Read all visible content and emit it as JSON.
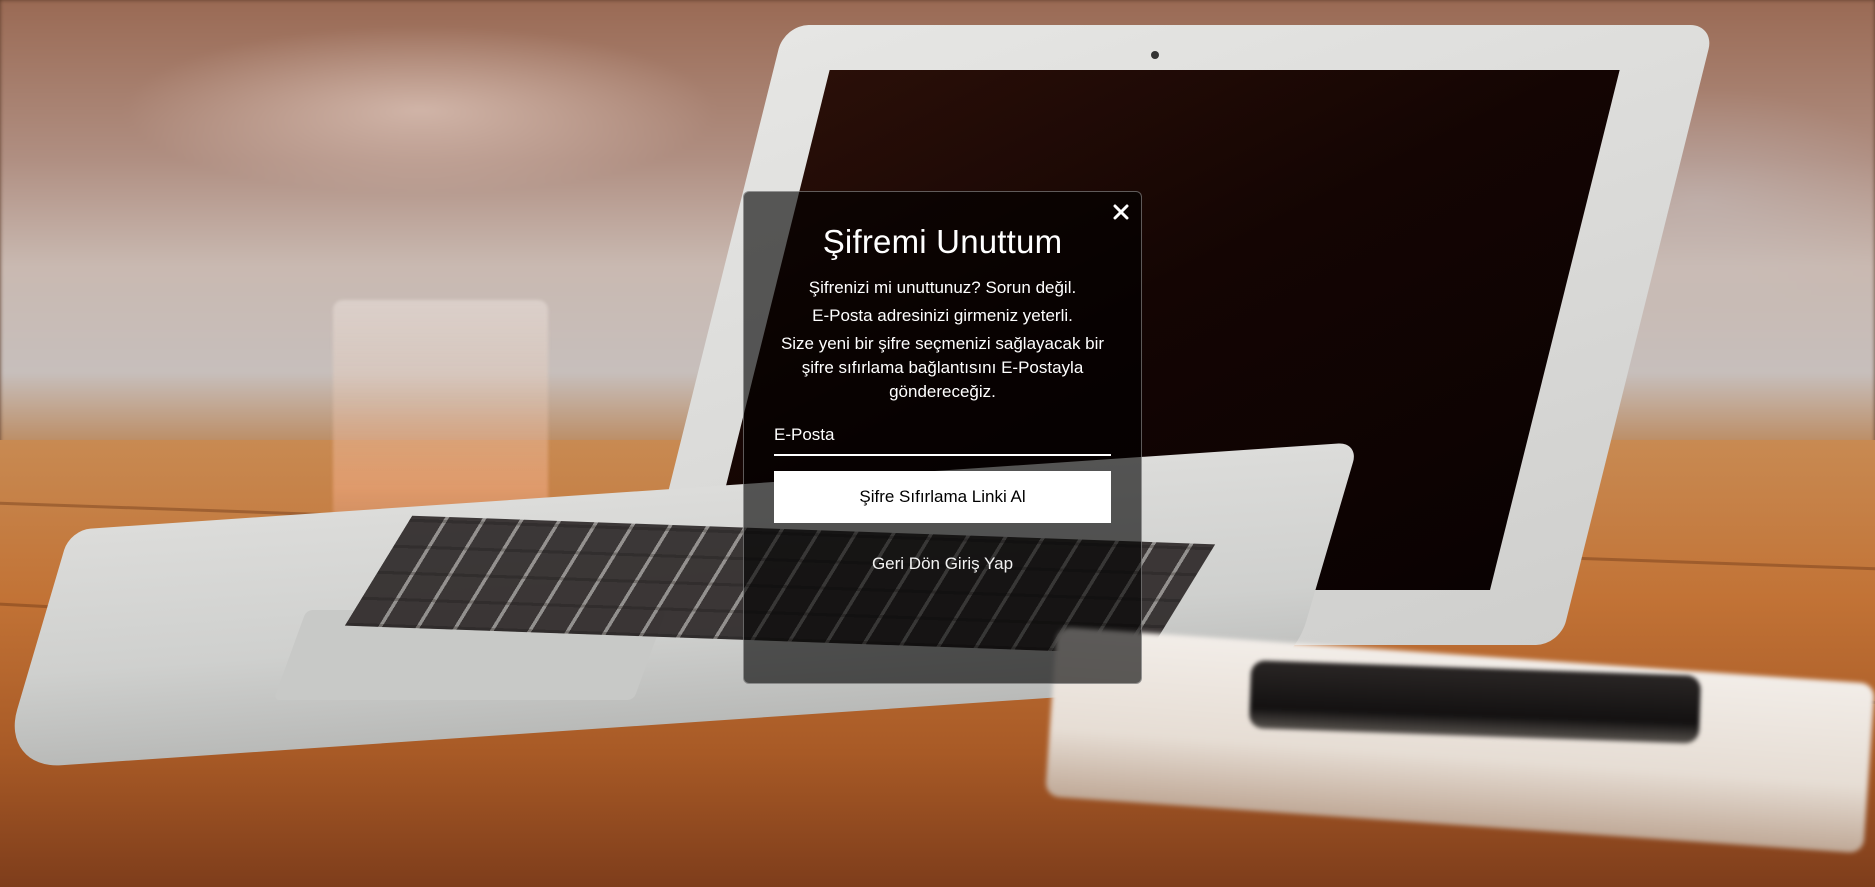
{
  "modal": {
    "title": "Şifremi Unuttum",
    "line1": "Şifrenizi mi unuttunuz? Sorun değil.",
    "line2": "E-Posta adresinizi girmeniz yeterli.",
    "line3": "Size yeni bir şifre seçmenizi sağlayacak bir şifre sıfırlama bağlantısını E-Postayla göndereceğiz.",
    "email_placeholder": "E-Posta",
    "email_value": "",
    "submit_label": "Şifre Sıfırlama Linki Al",
    "back_label": "Geri Dön Giriş Yap",
    "close_icon": "close-icon"
  },
  "colors": {
    "overlay": "#000000",
    "text": "#ffffff",
    "button_bg": "#ffffff",
    "button_text": "#000000"
  }
}
